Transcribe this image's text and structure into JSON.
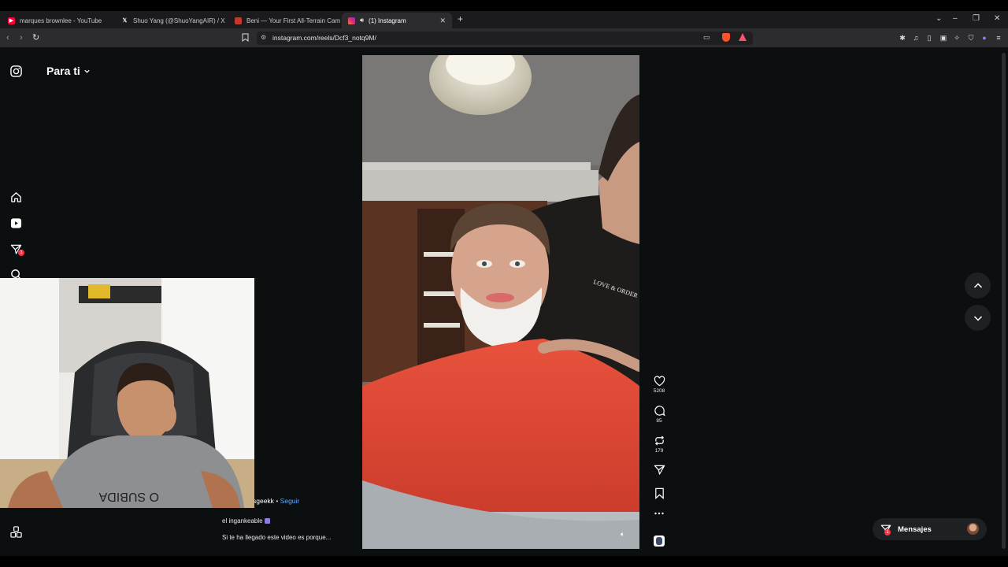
{
  "browser": {
    "tabs": [
      {
        "title": "marques brownlee - YouTube",
        "icon": "youtube-icon",
        "color": "#ff0033"
      },
      {
        "title": "Shuo Yang (@ShuoYangAIR) / X",
        "icon": "x-icon",
        "color": "#000000"
      },
      {
        "title": "Beni — Your First All-Terrain Camera",
        "icon": "beni-icon",
        "color": "#c0392b"
      },
      {
        "title": "(1) Instagram",
        "icon": "instagram-icon",
        "color": "#e1306c"
      }
    ],
    "new_tab_label": "+",
    "url": "instagram.com/reels/Dcf3_notq9M/"
  },
  "header": {
    "title": "Para ti"
  },
  "sidebar": {
    "notification_badge": "1"
  },
  "reel": {
    "shirt_text": "LOVE & ORDER",
    "likes": "5208",
    "comments": "85",
    "reposts": "179",
    "author_partial": "sgeekk",
    "separator": "•",
    "follow_label": "Seguir",
    "caption_line1": "el ingankeable",
    "caption_line2": "Si te ha llegado este video es porque..."
  },
  "messages": {
    "label": "Mensajes",
    "badge": "1"
  },
  "webcam": {
    "shirt_text": "O SUBIDA"
  },
  "colors": {
    "page_bg": "#0c0f10",
    "accent_link": "#5fa8ff",
    "badge_red": "#ff3040"
  }
}
